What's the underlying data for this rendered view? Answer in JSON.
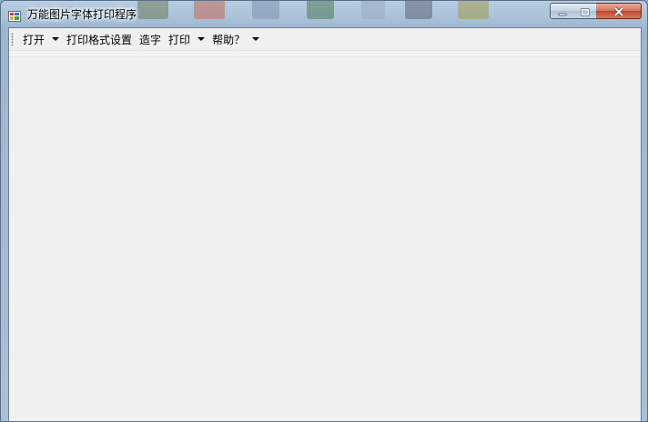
{
  "window": {
    "title": "万能图片字体打印程序",
    "icon": "application-icon"
  },
  "title_controls": {
    "minimize_icon": "minimize-icon",
    "maximize_icon": "maximize-icon",
    "close_icon": "close-icon"
  },
  "menu": {
    "items": [
      {
        "label": "打开",
        "has_dropdown": true
      },
      {
        "label": "打印格式设置",
        "has_dropdown": false
      },
      {
        "label": "造字",
        "has_dropdown": false
      },
      {
        "label": "打印",
        "has_dropdown": true
      },
      {
        "label": "帮助？",
        "has_dropdown": true
      }
    ]
  },
  "colors": {
    "client_background": "#f0f0f0",
    "frame": "#a9c0d8",
    "close_button": "#c1452b"
  }
}
